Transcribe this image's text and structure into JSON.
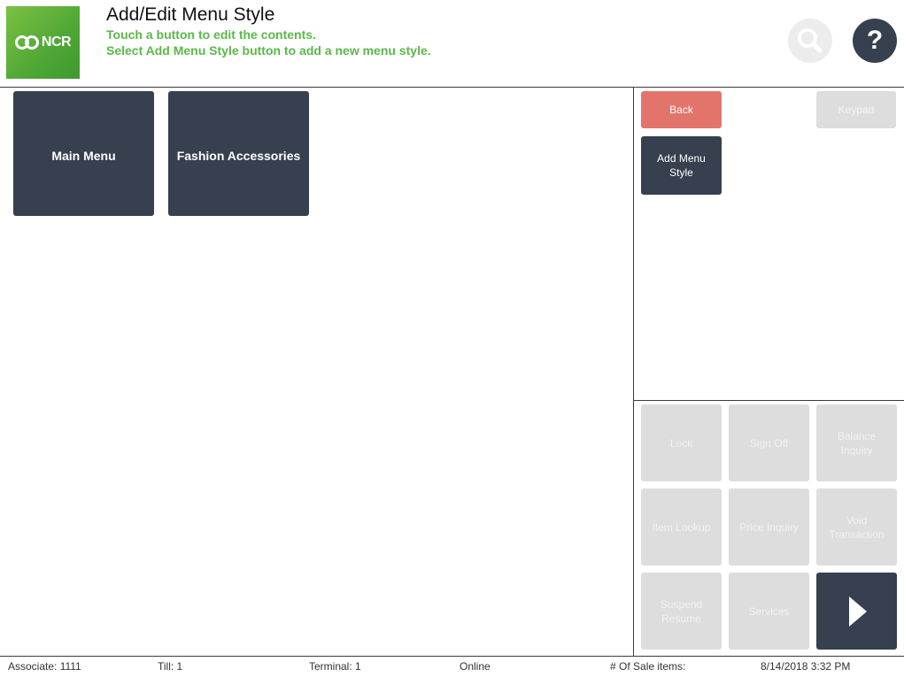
{
  "header": {
    "logo_text": "NCR",
    "title": "Add/Edit Menu Style",
    "subtitle1": "Touch a button to edit the contents.",
    "subtitle2": "Select Add Menu Style button to add a new menu style.",
    "help_label": "?"
  },
  "menu_styles": [
    {
      "label": "Main Menu"
    },
    {
      "label": "Fashion Accessories"
    }
  ],
  "side": {
    "back_label": "Back",
    "keypad_label": "Keypad",
    "add_label": "Add Menu Style"
  },
  "function_grid": [
    {
      "label": "Lock"
    },
    {
      "label": "Sign Off"
    },
    {
      "label": "Balance Inquiry"
    },
    {
      "label": "Item Lookup"
    },
    {
      "label": "Price Inquiry"
    },
    {
      "label": "Void Transaction"
    },
    {
      "label": "Suspend Resume"
    },
    {
      "label": "Services"
    }
  ],
  "footer": {
    "associate": "Associate: 1111",
    "till": "Till: 1",
    "terminal": "Terminal: 1",
    "status": "Online",
    "sale_items": "# Of Sale items:",
    "datetime": "8/14/2018 3:32 PM"
  },
  "colors": {
    "accent_green": "#5ab849",
    "dark_tile": "#36404f",
    "back_red": "#e3746c",
    "disabled_gray": "#dddddd"
  },
  "icons": {
    "search": "search-icon",
    "help": "help-icon",
    "next": "chevron-right-icon"
  }
}
